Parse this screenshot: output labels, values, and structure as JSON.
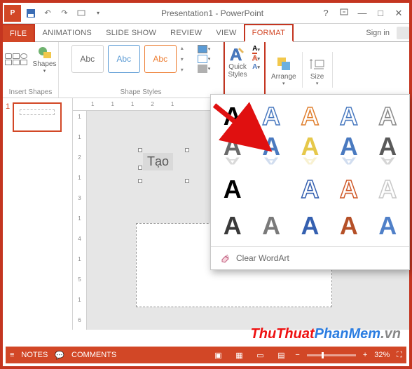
{
  "title": "Presentation1 - PowerPoint",
  "tabs": {
    "file": "FILE",
    "animations": "ANIMATIONS",
    "slideshow": "SLIDE SHOW",
    "review": "REVIEW",
    "view": "VIEW",
    "format": "FORMAT"
  },
  "signin": "Sign in",
  "ribbon": {
    "shapes": "Shapes",
    "insert_shapes": "Insert Shapes",
    "shape_styles": "Shape Styles",
    "abc": "Abc",
    "quick_styles": "Quick Styles",
    "arrange": "Arrange",
    "size": "Size"
  },
  "gallery": {
    "clear": "Clear WordArt",
    "colors": [
      [
        "#000000",
        "#4a7ac0",
        "#e08030",
        "#4a7ac0",
        "#8a8a8a"
      ],
      [
        "#6a6a6a",
        "#4a7ac0",
        "#e6c84a",
        "#4a7ac0",
        "#5a5a5a"
      ],
      [
        "#000000",
        "#000000",
        "#3560b0",
        "#d05a2a",
        "#c8c8c8"
      ],
      [
        "#3a3a3a",
        "#7a7a7a",
        "#3560b0",
        "#b55028",
        "#5080c8"
      ]
    ],
    "reflect_row": 1,
    "outline_rows": [
      2
    ],
    "pattern_row": 3
  },
  "ruler_h": [
    "1",
    "1",
    "1",
    "2",
    "1"
  ],
  "ruler_v": [
    "1",
    "1",
    "2",
    "1",
    "3",
    "1",
    "4",
    "1",
    "5",
    "1",
    "6"
  ],
  "slide_num": "1",
  "textbox": "Tạo",
  "status": {
    "notes": "NOTES",
    "comments": "COMMENTS",
    "zoom": "32%"
  },
  "watermark": {
    "a": "ThuThuat",
    "b": "PhanMem",
    "c": ".vn"
  }
}
